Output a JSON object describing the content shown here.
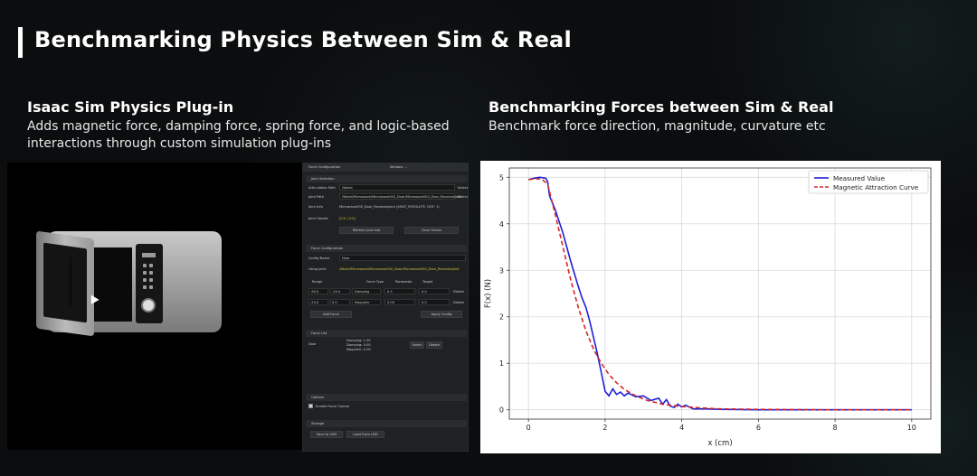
{
  "slide": {
    "title": "Benchmarking Physics Between Sim & Real"
  },
  "left": {
    "heading": "Isaac Sim Physics Plug-in",
    "desc_line1": "Adds magnetic force, damping force, spring force, and logic-based",
    "desc_line2": "interactions through custom simulation plug-ins"
  },
  "right": {
    "heading": "Benchmarking Forces between Sim & Real",
    "desc": "Benchmark force direction, magnitude, curvature etc"
  },
  "panel": {
    "title": "Force Configuration",
    "title_right": "Window ...",
    "sec_joint": "Joint Selection",
    "articulation_label": "Articulation Path",
    "articulation_value": "/World",
    "select_label": "Select",
    "joint_path_label": "Joint Path",
    "joint_path_value": "/World/Microwave/Microwave000_Door/Microwave000_Door_Revolutejoint",
    "joint_info_label": "Joint Info",
    "joint_info_value": "Microwave000_Door_Revolutejoint (JOINT_REVOLUTE, DOF: 1)",
    "joint_handle_label": "Joint Handle",
    "joint_handle_value": "[0:0 | 0:0]",
    "refresh_label": "Refresh Joint Info",
    "clear_label": "Clear Forces",
    "sec_force": "Force Configuration",
    "config_name_label": "Config Name",
    "config_name_value": "Door",
    "using_joint_label": "Using Joint",
    "using_joint_value": "/World/Microwave/Microwave000_Door/Microwave000_Door_Revolutejoint",
    "col_range": "Range",
    "col_force_type": "Force Type",
    "col_parameter": "Parameter",
    "col_target": "Target",
    "row1": {
      "a": "-90.0",
      "b": "-20.0",
      "type": "Damping",
      "param": "0.5",
      "target": "0.0",
      "del": "Delete"
    },
    "row2": {
      "a": "-20.0",
      "b": "0.0",
      "type": "Magnetic",
      "param": "0.00",
      "target": "0.0",
      "del": "Delete"
    },
    "add_force": "Add Force",
    "apply_config": "Apply Config",
    "sec_list": "Force List",
    "list_name": "Door",
    "list_damping": "Damping: 1.00",
    "list_spring": "Damping: 0.00",
    "list_magnetic": "Magnetic: 0.00",
    "select_btn": "Select",
    "delete_btn": "Delete",
    "sec_options": "Options",
    "enable_force": "Enable Force Control",
    "sec_storage": "Storage",
    "save_usd": "Save to USD",
    "load_usd": "Load From USD"
  },
  "chart_data": {
    "type": "line",
    "xlabel": "x (cm)",
    "ylabel": "F(x) (N)",
    "xlim": [
      -0.5,
      10.5
    ],
    "ylim": [
      -0.2,
      5.2
    ],
    "xticks": [
      0,
      2,
      4,
      6,
      8,
      10
    ],
    "yticks": [
      0,
      1,
      2,
      3,
      4,
      5
    ],
    "grid": true,
    "legend_position": "top-right",
    "series": [
      {
        "name": "Measured Value",
        "color": "#1f1fd6",
        "style": "solid",
        "points": [
          [
            0,
            4.95
          ],
          [
            0.15,
            4.98
          ],
          [
            0.3,
            5.0
          ],
          [
            0.45,
            4.98
          ],
          [
            0.5,
            4.9
          ],
          [
            0.55,
            4.6
          ],
          [
            0.7,
            4.3
          ],
          [
            0.9,
            3.8
          ],
          [
            1.1,
            3.2
          ],
          [
            1.3,
            2.65
          ],
          [
            1.4,
            2.4
          ],
          [
            1.5,
            2.2
          ],
          [
            1.6,
            1.9
          ],
          [
            1.7,
            1.55
          ],
          [
            1.8,
            1.2
          ],
          [
            1.9,
            0.8
          ],
          [
            2.0,
            0.4
          ],
          [
            2.1,
            0.3
          ],
          [
            2.2,
            0.45
          ],
          [
            2.3,
            0.33
          ],
          [
            2.4,
            0.38
          ],
          [
            2.5,
            0.3
          ],
          [
            2.6,
            0.36
          ],
          [
            2.8,
            0.28
          ],
          [
            3.0,
            0.3
          ],
          [
            3.2,
            0.2
          ],
          [
            3.4,
            0.25
          ],
          [
            3.5,
            0.12
          ],
          [
            3.6,
            0.22
          ],
          [
            3.7,
            0.08
          ],
          [
            3.8,
            0.05
          ],
          [
            3.9,
            0.12
          ],
          [
            4.0,
            0.06
          ],
          [
            4.1,
            0.1
          ],
          [
            4.3,
            0.02
          ],
          [
            4.6,
            0.02
          ],
          [
            5.0,
            0.01
          ],
          [
            6.0,
            0.0
          ],
          [
            8.0,
            0.0
          ],
          [
            10.0,
            0.0
          ]
        ]
      },
      {
        "name": "Magnetic Attraction Curve",
        "color": "#d62728",
        "style": "dashed",
        "points": [
          [
            0,
            4.95
          ],
          [
            0.2,
            4.97
          ],
          [
            0.35,
            4.96
          ],
          [
            0.5,
            4.85
          ],
          [
            0.7,
            4.2
          ],
          [
            0.9,
            3.5
          ],
          [
            1.1,
            2.8
          ],
          [
            1.3,
            2.2
          ],
          [
            1.5,
            1.7
          ],
          [
            1.7,
            1.3
          ],
          [
            1.9,
            1.0
          ],
          [
            2.1,
            0.76
          ],
          [
            2.3,
            0.58
          ],
          [
            2.5,
            0.44
          ],
          [
            2.8,
            0.3
          ],
          [
            3.1,
            0.2
          ],
          [
            3.5,
            0.12
          ],
          [
            4.0,
            0.07
          ],
          [
            4.5,
            0.04
          ],
          [
            5.0,
            0.02
          ],
          [
            6.0,
            0.01
          ],
          [
            8.0,
            0.0
          ],
          [
            10.0,
            0.0
          ]
        ]
      }
    ]
  }
}
